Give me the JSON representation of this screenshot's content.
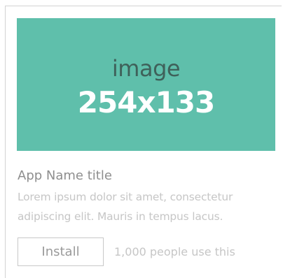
{
  "card": {
    "image": {
      "label": "image",
      "dimensions": "254x133",
      "background_color": "#5fbfab"
    },
    "title": "App Name title",
    "description": "Lorem ipsum dolor sit amet, consectetur adipiscing elit. Mauris in tempus lacus.",
    "install_label": "Install",
    "users_text": "1,000 people use this"
  }
}
